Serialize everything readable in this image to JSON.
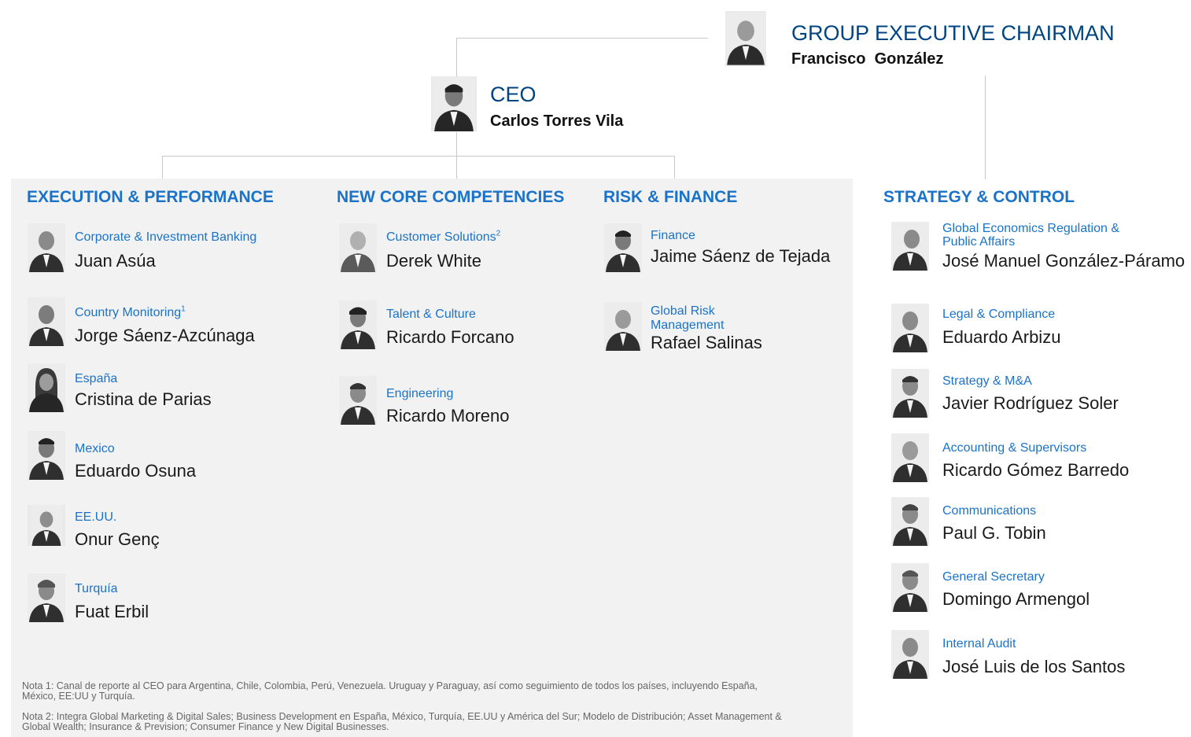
{
  "chairman": {
    "role": "GROUP EXECUTIVE CHAIRMAN",
    "name": "Francisco  González"
  },
  "ceo": {
    "role": "CEO",
    "name": "Carlos Torres Vila"
  },
  "sections": {
    "execution": {
      "title": "EXECUTION & PERFORMANCE",
      "people": [
        {
          "role": "Corporate & Investment Banking",
          "name": "Juan Asúa"
        },
        {
          "role": "Country Monitoring",
          "sup": "1",
          "name": "Jorge Sáenz-Azcúnaga"
        },
        {
          "role": "España",
          "name": "Cristina de Parias"
        },
        {
          "role": "Mexico",
          "name": "Eduardo Osuna"
        },
        {
          "role": "EE.UU.",
          "name": "Onur Genç"
        },
        {
          "role": "Turquía",
          "name": "Fuat Erbil"
        }
      ]
    },
    "core": {
      "title": "NEW CORE COMPETENCIES",
      "people": [
        {
          "role": "Customer Solutions",
          "sup": "2",
          "name": "Derek White"
        },
        {
          "role": "Talent & Culture",
          "name": "Ricardo Forcano"
        },
        {
          "role": "Engineering",
          "name": "Ricardo Moreno"
        }
      ]
    },
    "risk": {
      "title": "RISK & FINANCE",
      "people": [
        {
          "role": "Finance",
          "name": "Jaime Sáenz de Tejada"
        },
        {
          "role": "Global Risk Management",
          "name": "Rafael Salinas"
        }
      ]
    },
    "strategy": {
      "title": "STRATEGY & CONTROL",
      "people": [
        {
          "role": "Global Economics Regulation & Public Affairs",
          "name": "José Manuel González-Páramo"
        },
        {
          "role": "Legal & Compliance",
          "name": "Eduardo Arbizu"
        },
        {
          "role": "Strategy & M&A",
          "name": "Javier Rodríguez Soler"
        },
        {
          "role": "Accounting & Supervisors",
          "name": "Ricardo Gómez Barredo"
        },
        {
          "role": "Communications",
          "name": "Paul G. Tobin"
        },
        {
          "role": "General Secretary",
          "name": "Domingo Armengol"
        },
        {
          "role": "Internal Audit",
          "name": "José Luis de los Santos"
        }
      ]
    }
  },
  "notes": [
    "Nota 1: Canal de reporte al CEO para Argentina, Chile, Colombia, Perú, Venezuela. Uruguay y Paraguay, así como seguimiento de todos los países, incluyendo España, México, EE:UU y Turquía.",
    "Nota 2: Integra Global Marketing & Digital Sales; Business Development en España, México, Turquía, EE.UU y América del Sur; Modelo de Distribución; Asset Management & Global Wealth; Insurance & Prevision; Consumer Finance y New Digital Businesses."
  ]
}
